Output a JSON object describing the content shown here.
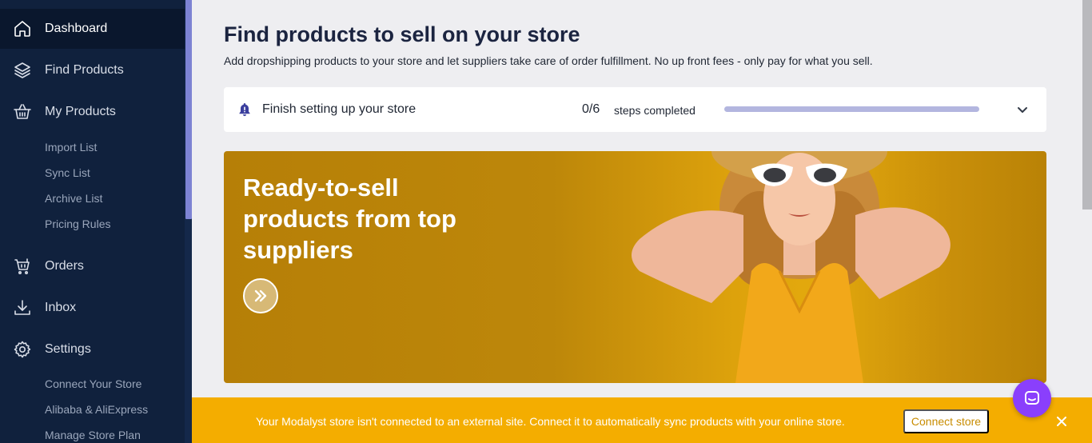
{
  "sidebar": {
    "items": [
      {
        "label": "Dashboard",
        "icon": "home-icon",
        "active": true
      },
      {
        "label": "Find Products",
        "icon": "layers-icon"
      },
      {
        "label": "My Products",
        "icon": "basket-icon"
      },
      {
        "label": "Orders",
        "icon": "cart-icon"
      },
      {
        "label": "Inbox",
        "icon": "download-icon"
      },
      {
        "label": "Settings",
        "icon": "gear-icon"
      }
    ],
    "my_products_sub": [
      "Import List",
      "Sync List",
      "Archive List",
      "Pricing Rules"
    ],
    "settings_sub": [
      "Connect Your Store",
      "Alibaba & AliExpress",
      "Manage Store Plan"
    ]
  },
  "main": {
    "title": "Find products to sell on your store",
    "subtitle": "Add dropshipping products to your store and let suppliers take care of order fulfillment. No up front fees - only pay for what you sell."
  },
  "setup": {
    "title": "Finish setting up your store",
    "count": "0/6",
    "steps_label": "steps completed",
    "progress": 0
  },
  "banner": {
    "title": "Ready-to-sell products from top suppliers"
  },
  "notice": {
    "text": "Your Modalyst store isn't connected to an external site. Connect it to automatically sync products with your online store.",
    "button": "Connect store"
  },
  "colors": {
    "sidebar_bg": "#10213d",
    "accent": "#6f73c9",
    "notice_bg": "#f4ad00",
    "chat_bubble": "#8a3ffc"
  }
}
